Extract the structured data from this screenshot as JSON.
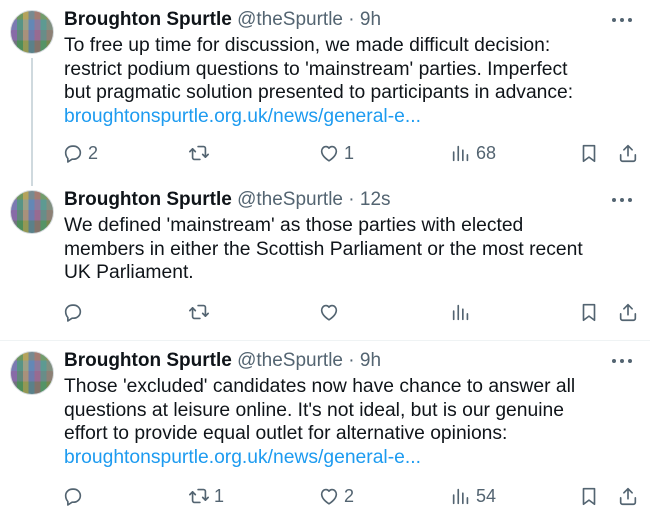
{
  "tweets": [
    {
      "author": {
        "name": "Broughton Spurtle",
        "handle": "@theSpurtle"
      },
      "separator": "·",
      "time": "9h",
      "lines": [
        "To free up time for discussion, we made difficult decision:",
        "restrict podium questions to 'mainstream' parties. Imperfect",
        "but pragmatic solution presented to participants in advance:"
      ],
      "link": "broughtonspurtle.org.uk/news/general-e...",
      "stats": {
        "replies": "2",
        "retweets": "",
        "likes": "1",
        "views": "68"
      }
    },
    {
      "author": {
        "name": "Broughton Spurtle",
        "handle": "@theSpurtle"
      },
      "separator": "·",
      "time": "12s",
      "lines": [
        "We defined 'mainstream' as those parties with elected",
        "members in either the Scottish Parliament or the most recent",
        "UK Parliament."
      ],
      "link": "",
      "stats": {
        "replies": "",
        "retweets": "",
        "likes": "",
        "views": ""
      }
    },
    {
      "author": {
        "name": "Broughton Spurtle",
        "handle": "@theSpurtle"
      },
      "separator": "·",
      "time": "9h",
      "lines": [
        "Those 'excluded' candidates now have chance to answer all",
        "questions at leisure online. It's not ideal, but is our genuine",
        "effort to provide equal outlet for alternative opinions:"
      ],
      "link": "broughtonspurtle.org.uk/news/general-e...",
      "stats": {
        "replies": "",
        "retweets": "1",
        "likes": "2",
        "views": "54"
      }
    }
  ],
  "colors": {
    "text": "#0f1419",
    "secondary": "#536471",
    "link": "#1d9bf0",
    "divider": "#eff3f4"
  },
  "icons": [
    "reply-icon",
    "retweet-icon",
    "like-icon",
    "views-icon",
    "bookmark-icon",
    "share-icon",
    "more-icon"
  ]
}
